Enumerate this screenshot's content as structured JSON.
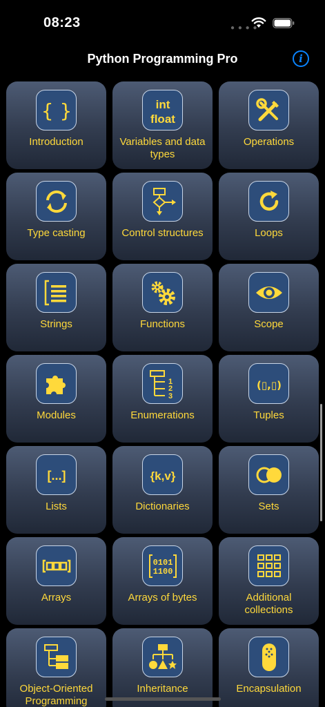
{
  "status": {
    "time": "08:23"
  },
  "nav": {
    "title": "Python Programming Pro"
  },
  "colors": {
    "accent": "#ffd93b",
    "info": "#0a84ff",
    "tile_top": "#4d5b74",
    "tile_bottom": "#202837"
  },
  "tiles": [
    {
      "label": "Introduction",
      "icon": "braces-icon"
    },
    {
      "label": "Variables and data types",
      "icon": "int-float-icon",
      "icon_text": [
        "int",
        "float"
      ]
    },
    {
      "label": "Operations",
      "icon": "tools-icon"
    },
    {
      "label": "Type casting",
      "icon": "cycle-arrows-icon"
    },
    {
      "label": "Control structures",
      "icon": "flowchart-icon"
    },
    {
      "label": "Loops",
      "icon": "refresh-icon"
    },
    {
      "label": "Strings",
      "icon": "text-lines-icon"
    },
    {
      "label": "Functions",
      "icon": "gears-icon"
    },
    {
      "label": "Scope",
      "icon": "eye-icon"
    },
    {
      "label": "Modules",
      "icon": "puzzle-icon"
    },
    {
      "label": "Enumerations",
      "icon": "numbered-list-icon",
      "icon_text": [
        "1",
        "2",
        "3"
      ]
    },
    {
      "label": "Tuples",
      "icon": "tuple-icon",
      "icon_text": "(▯,▯)"
    },
    {
      "label": "Lists",
      "icon": "list-brackets-icon",
      "icon_text": "[...]"
    },
    {
      "label": "Dictionaries",
      "icon": "key-value-icon",
      "icon_text": "{k,v}"
    },
    {
      "label": "Sets",
      "icon": "sets-icon"
    },
    {
      "label": "Arrays",
      "icon": "array-icon"
    },
    {
      "label": "Arrays of bytes",
      "icon": "bytes-icon",
      "icon_text": [
        "0101",
        "1100"
      ]
    },
    {
      "label": "Additional collections",
      "icon": "collections-grid-icon"
    },
    {
      "label": "Object-Oriented Programming",
      "icon": "class-tree-icon"
    },
    {
      "label": "Inheritance",
      "icon": "hierarchy-icon"
    },
    {
      "label": "Encapsulation",
      "icon": "capsule-icon"
    }
  ]
}
